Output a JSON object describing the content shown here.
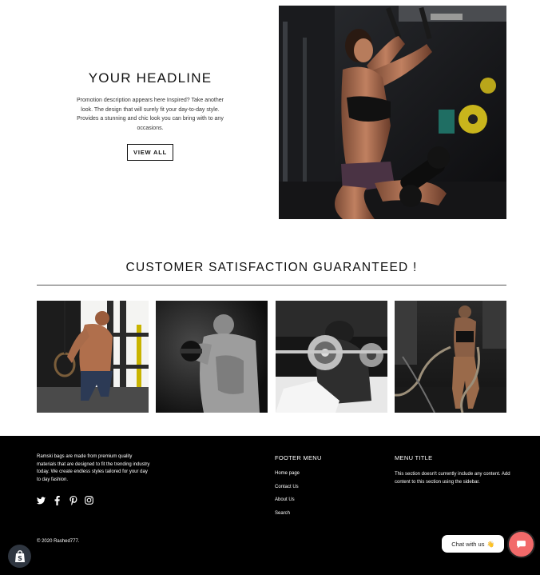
{
  "hero": {
    "headline": "YOUR HEADLINE",
    "description": "Promotion description appears here Inspired? Take another look. The design that will surely fit your day-to-day style. Provides a stunning and chic look you can bring with to any occasions.",
    "button_label": "VIEW ALL"
  },
  "satisfaction": {
    "title": "CUSTOMER SATISFACTION GUARANTEED !"
  },
  "footer": {
    "about": "Ramski bags are made from premium quality materials that are designed to fit the trending industry today. We create endless styles tailored for your day to day fashion.",
    "social_icons": [
      "twitter-icon",
      "facebook-icon",
      "pinterest-icon",
      "instagram-icon"
    ],
    "menu_title": "FOOTER MENU",
    "menu_items": [
      "Home page",
      "Contact Us",
      "About Us",
      "Search"
    ],
    "info_title": "MENU TITLE",
    "info_text": "This section doesn't currently include any content. Add content to this section using the sidebar.",
    "copyright": "© 2020 Rashed777."
  },
  "chat": {
    "label": "Chat with us",
    "emoji": "👋"
  },
  "colors": {
    "footer_bg": "#000000",
    "chat_button": "#f26a6a",
    "shopify_badge": "#2f3640"
  }
}
